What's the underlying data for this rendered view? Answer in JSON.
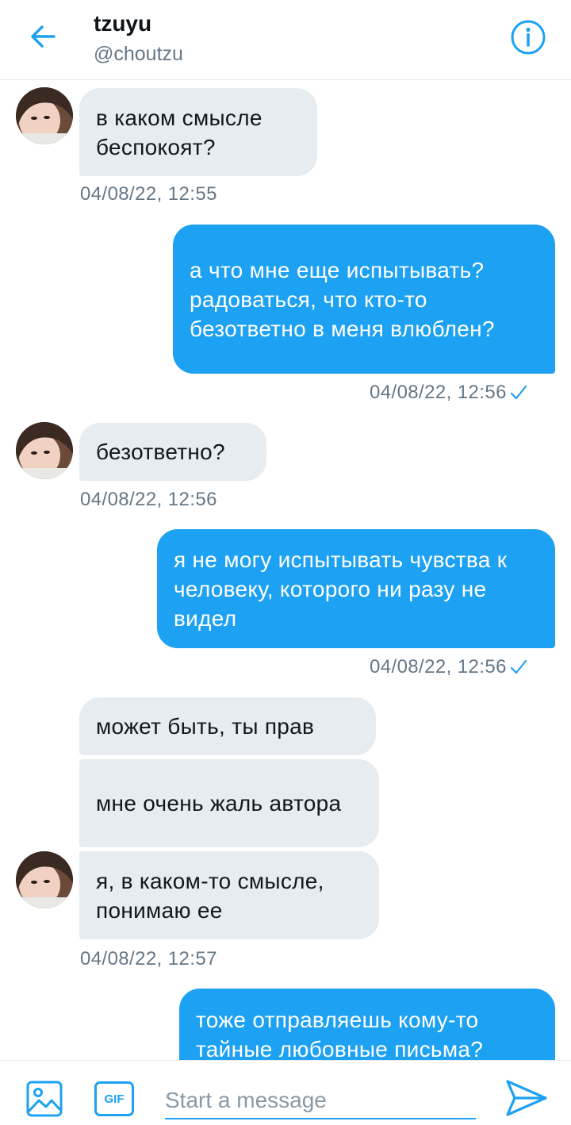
{
  "header": {
    "name": "tzuyu",
    "handle": "@choutzu",
    "back_icon": "arrow-left-icon",
    "info_icon": "info-icon",
    "accent": "#1da1f2"
  },
  "thread": {
    "messages": [
      {
        "dir": "in",
        "text": "в каком смысле беспокоят?"
      },
      {
        "dir": "out",
        "text": "а что мне еще испытывать? радоваться, что кто-то безответно в меня влюблен?"
      },
      {
        "dir": "in",
        "text": "безответно?"
      },
      {
        "dir": "out",
        "text": "я не могу испытывать чувства к человеку, которого ни разу не видел"
      },
      {
        "dir": "in",
        "text": "может быть, ты прав"
      },
      {
        "dir": "in",
        "text": "мне очень жаль автора"
      },
      {
        "dir": "in",
        "text": "я, в каком-то смысле, понимаю ее"
      },
      {
        "dir": "out",
        "text": "тоже отправляешь кому-то тайные любовные письма?"
      }
    ],
    "timestamps": [
      "04/08/22, 12:55",
      "04/08/22, 12:56",
      "04/08/22, 12:56",
      "04/08/22, 12:56",
      "04/08/22, 12:57"
    ],
    "sent_icon": "checkmark-icon"
  },
  "composer": {
    "gif_label": "GIF",
    "placeholder": "Start a message",
    "image_icon": "image-icon",
    "send_icon": "send-icon"
  }
}
